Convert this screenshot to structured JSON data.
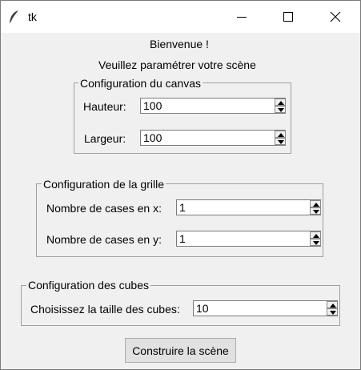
{
  "window": {
    "title": "tk",
    "controls": {
      "minimize": "minimize-icon",
      "maximize": "maximize-icon",
      "close": "close-icon"
    }
  },
  "header": {
    "welcome": "Bienvenue !",
    "instruction": "Veuillez paramétrer votre scène"
  },
  "canvas_config": {
    "legend": "Configuration du canvas",
    "height_label": "Hauteur:",
    "height_value": "100",
    "width_label": "Largeur:",
    "width_value": "100"
  },
  "grid_config": {
    "legend": "Configuration de la grille",
    "x_label": "Nombre de cases en x:",
    "x_value": "1",
    "y_label": "Nombre de cases en y:",
    "y_value": "1"
  },
  "cube_config": {
    "legend": "Configuration des cubes",
    "size_label": "Choisissez la taille des cubes:",
    "size_value": "10"
  },
  "actions": {
    "build_label": "Construire la scène"
  }
}
